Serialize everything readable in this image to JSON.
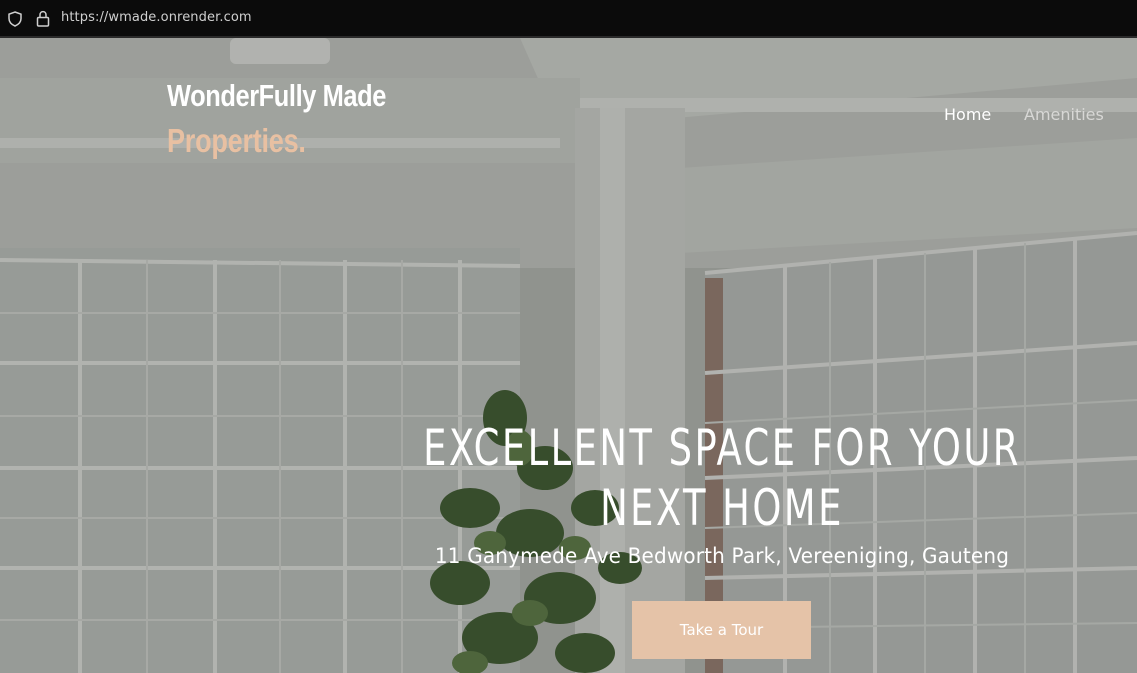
{
  "browser": {
    "url": "https://wmade.onrender.com"
  },
  "brand": {
    "line1": "WonderFully Made",
    "line2": "Properties."
  },
  "nav": {
    "items": [
      {
        "label": "Home"
      },
      {
        "label": "Amenities"
      }
    ]
  },
  "hero": {
    "headline": "EXCELLENT SPACE FOR YOUR NEXT HOME",
    "address": "11 Ganymede Ave Bedworth Park, Vereeniging, Gauteng",
    "cta_label": "Take a Tour"
  },
  "colors": {
    "accent": "#e5c3a8",
    "brand_secondary": "#e8c0a2",
    "browser_bar": "#0b0b0b"
  },
  "icons": [
    "shield-icon",
    "lock-icon"
  ]
}
